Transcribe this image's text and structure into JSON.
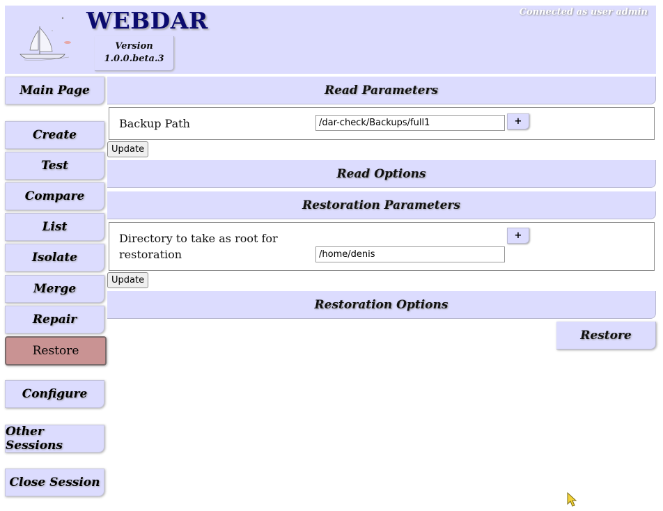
{
  "header": {
    "title": "WEBDAR",
    "version_line1": "Version",
    "version_line2": "1.0.0.beta.3",
    "connected": "Connected as user admin"
  },
  "sidebar": {
    "items": [
      {
        "label": "Main Page"
      },
      {
        "label": "Create"
      },
      {
        "label": "Test"
      },
      {
        "label": "Compare"
      },
      {
        "label": "List"
      },
      {
        "label": "Isolate"
      },
      {
        "label": "Merge"
      },
      {
        "label": "Repair"
      },
      {
        "label": "Restore",
        "active": true
      },
      {
        "label": "Configure"
      },
      {
        "label": "Other Sessions"
      },
      {
        "label": "Close Session"
      }
    ]
  },
  "main": {
    "read_parameters": {
      "title": "Read Parameters",
      "backup_path_label": "Backup Path",
      "backup_path_value": "/dar-check/Backups/full1",
      "plus_label": "+",
      "update_label": "Update"
    },
    "read_options": {
      "title": "Read Options"
    },
    "restoration_parameters": {
      "title": "Restoration Parameters",
      "root_dir_label_line1": "Directory to take as root for",
      "root_dir_label_line2": "restoration",
      "root_dir_value": "/home/denis",
      "plus_label": "+",
      "update_label": "Update"
    },
    "restoration_options": {
      "title": "Restoration Options"
    },
    "restore_button": "Restore"
  },
  "colors": {
    "panel": "#dcdcfe",
    "active_nav": "#c99393",
    "title": "#0b0b6e"
  }
}
